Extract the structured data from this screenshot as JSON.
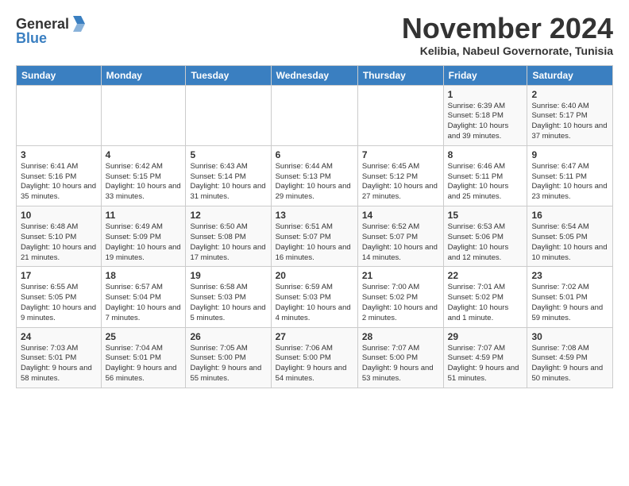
{
  "logo": {
    "general": "General",
    "blue": "Blue"
  },
  "header": {
    "month": "November 2024",
    "location": "Kelibia, Nabeul Governorate, Tunisia"
  },
  "weekdays": [
    "Sunday",
    "Monday",
    "Tuesday",
    "Wednesday",
    "Thursday",
    "Friday",
    "Saturday"
  ],
  "weeks": [
    [
      {
        "day": "",
        "info": ""
      },
      {
        "day": "",
        "info": ""
      },
      {
        "day": "",
        "info": ""
      },
      {
        "day": "",
        "info": ""
      },
      {
        "day": "",
        "info": ""
      },
      {
        "day": "1",
        "info": "Sunrise: 6:39 AM\nSunset: 5:18 PM\nDaylight: 10 hours and 39 minutes."
      },
      {
        "day": "2",
        "info": "Sunrise: 6:40 AM\nSunset: 5:17 PM\nDaylight: 10 hours and 37 minutes."
      }
    ],
    [
      {
        "day": "3",
        "info": "Sunrise: 6:41 AM\nSunset: 5:16 PM\nDaylight: 10 hours and 35 minutes."
      },
      {
        "day": "4",
        "info": "Sunrise: 6:42 AM\nSunset: 5:15 PM\nDaylight: 10 hours and 33 minutes."
      },
      {
        "day": "5",
        "info": "Sunrise: 6:43 AM\nSunset: 5:14 PM\nDaylight: 10 hours and 31 minutes."
      },
      {
        "day": "6",
        "info": "Sunrise: 6:44 AM\nSunset: 5:13 PM\nDaylight: 10 hours and 29 minutes."
      },
      {
        "day": "7",
        "info": "Sunrise: 6:45 AM\nSunset: 5:12 PM\nDaylight: 10 hours and 27 minutes."
      },
      {
        "day": "8",
        "info": "Sunrise: 6:46 AM\nSunset: 5:11 PM\nDaylight: 10 hours and 25 minutes."
      },
      {
        "day": "9",
        "info": "Sunrise: 6:47 AM\nSunset: 5:11 PM\nDaylight: 10 hours and 23 minutes."
      }
    ],
    [
      {
        "day": "10",
        "info": "Sunrise: 6:48 AM\nSunset: 5:10 PM\nDaylight: 10 hours and 21 minutes."
      },
      {
        "day": "11",
        "info": "Sunrise: 6:49 AM\nSunset: 5:09 PM\nDaylight: 10 hours and 19 minutes."
      },
      {
        "day": "12",
        "info": "Sunrise: 6:50 AM\nSunset: 5:08 PM\nDaylight: 10 hours and 17 minutes."
      },
      {
        "day": "13",
        "info": "Sunrise: 6:51 AM\nSunset: 5:07 PM\nDaylight: 10 hours and 16 minutes."
      },
      {
        "day": "14",
        "info": "Sunrise: 6:52 AM\nSunset: 5:07 PM\nDaylight: 10 hours and 14 minutes."
      },
      {
        "day": "15",
        "info": "Sunrise: 6:53 AM\nSunset: 5:06 PM\nDaylight: 10 hours and 12 minutes."
      },
      {
        "day": "16",
        "info": "Sunrise: 6:54 AM\nSunset: 5:05 PM\nDaylight: 10 hours and 10 minutes."
      }
    ],
    [
      {
        "day": "17",
        "info": "Sunrise: 6:55 AM\nSunset: 5:05 PM\nDaylight: 10 hours and 9 minutes."
      },
      {
        "day": "18",
        "info": "Sunrise: 6:57 AM\nSunset: 5:04 PM\nDaylight: 10 hours and 7 minutes."
      },
      {
        "day": "19",
        "info": "Sunrise: 6:58 AM\nSunset: 5:03 PM\nDaylight: 10 hours and 5 minutes."
      },
      {
        "day": "20",
        "info": "Sunrise: 6:59 AM\nSunset: 5:03 PM\nDaylight: 10 hours and 4 minutes."
      },
      {
        "day": "21",
        "info": "Sunrise: 7:00 AM\nSunset: 5:02 PM\nDaylight: 10 hours and 2 minutes."
      },
      {
        "day": "22",
        "info": "Sunrise: 7:01 AM\nSunset: 5:02 PM\nDaylight: 10 hours and 1 minute."
      },
      {
        "day": "23",
        "info": "Sunrise: 7:02 AM\nSunset: 5:01 PM\nDaylight: 9 hours and 59 minutes."
      }
    ],
    [
      {
        "day": "24",
        "info": "Sunrise: 7:03 AM\nSunset: 5:01 PM\nDaylight: 9 hours and 58 minutes."
      },
      {
        "day": "25",
        "info": "Sunrise: 7:04 AM\nSunset: 5:01 PM\nDaylight: 9 hours and 56 minutes."
      },
      {
        "day": "26",
        "info": "Sunrise: 7:05 AM\nSunset: 5:00 PM\nDaylight: 9 hours and 55 minutes."
      },
      {
        "day": "27",
        "info": "Sunrise: 7:06 AM\nSunset: 5:00 PM\nDaylight: 9 hours and 54 minutes."
      },
      {
        "day": "28",
        "info": "Sunrise: 7:07 AM\nSunset: 5:00 PM\nDaylight: 9 hours and 53 minutes."
      },
      {
        "day": "29",
        "info": "Sunrise: 7:07 AM\nSunset: 4:59 PM\nDaylight: 9 hours and 51 minutes."
      },
      {
        "day": "30",
        "info": "Sunrise: 7:08 AM\nSunset: 4:59 PM\nDaylight: 9 hours and 50 minutes."
      }
    ]
  ]
}
